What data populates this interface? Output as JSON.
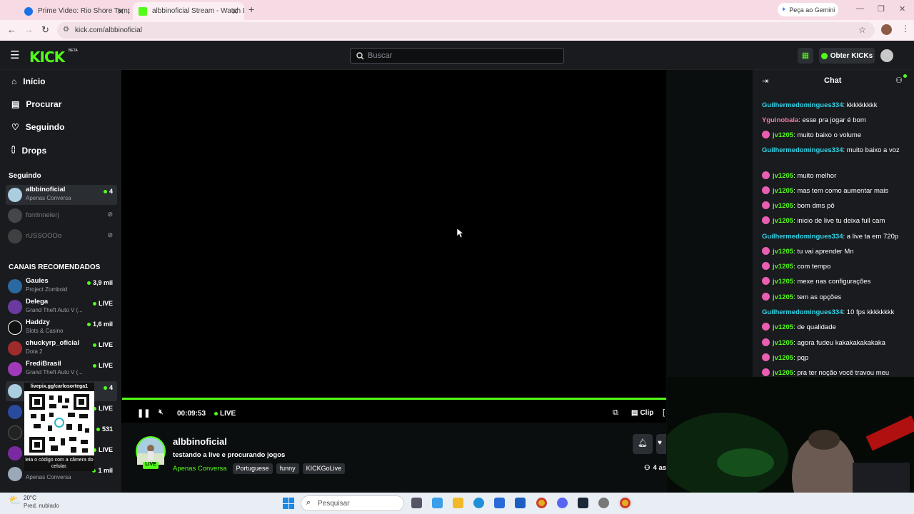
{
  "browser": {
    "tabs": [
      {
        "title": "Prime Video: Rio Shore Tempor..."
      },
      {
        "title": "albbinoficial Stream - Watch Li..."
      }
    ],
    "gemini_label": "Peça ao Gemini",
    "url": "kick.com/albbinoficial"
  },
  "header": {
    "logo": "KICK",
    "logo_badge": "BETA",
    "search_placeholder": "Buscar",
    "kicks_button": "Obter KICKs"
  },
  "sidebar": {
    "nav": [
      {
        "label": "Início"
      },
      {
        "label": "Procurar"
      },
      {
        "label": "Seguindo"
      },
      {
        "label": "Drops"
      }
    ],
    "following_title": "Seguindo",
    "following": [
      {
        "name": "albbinoficial",
        "category": "Apenas Conversa",
        "viewers": "4"
      },
      {
        "name": "fontinnelerj",
        "category": "",
        "viewers": ""
      },
      {
        "name": "rUSSOOOo",
        "category": "",
        "viewers": ""
      }
    ],
    "recommended_title": "CANAIS RECOMENDADOS",
    "recommended": [
      {
        "name": "Gaules",
        "category": "Project Zomboid",
        "viewers": "3,9 mil"
      },
      {
        "name": "Delega",
        "category": "Grand Theft Auto V (...",
        "viewers": "LIVE"
      },
      {
        "name": "Haddzy",
        "category": "Slots & Casino",
        "viewers": "1,6 mil"
      },
      {
        "name": "chuckyrp_oficial",
        "category": "Dota 2",
        "viewers": "LIVE"
      },
      {
        "name": "FrediBrasil",
        "category": "Grand Theft Auto V (...",
        "viewers": "LIVE"
      },
      {
        "name": "",
        "category": "",
        "viewers": "4"
      },
      {
        "name": "",
        "category": "",
        "viewers": "LIVE"
      },
      {
        "name": "",
        "category": "",
        "viewers": "531"
      },
      {
        "name": "",
        "category": "",
        "viewers": "LIVE"
      },
      {
        "name": "",
        "category": "Apenas Conversa",
        "viewers": "1 mil"
      }
    ],
    "qr": {
      "top": "livepix.gg/carlosortega1",
      "bottom": "leia o código com a câmera do celular."
    }
  },
  "player": {
    "time": "00:09:53",
    "live": "LIVE",
    "clip": "Clip",
    "progress": 1.0
  },
  "stream": {
    "channel": "albbinoficial",
    "title": "testando a live e procurando jogos",
    "category": "Apenas Conversa",
    "tags": [
      "Portuguese",
      "funny",
      "KICKGoLive"
    ],
    "live_badge": "LIVE",
    "viewers_snippet": "4 as"
  },
  "chat": {
    "title": "Chat",
    "messages": [
      {
        "user": "Guilhermedomingues334",
        "color": "cyan",
        "badge": false,
        "text": "kkkkkkkkk"
      },
      {
        "user": "Yguinobala",
        "color": "pink",
        "badge": false,
        "text": "esse pra jogar é bom"
      },
      {
        "user": "jv1205",
        "color": "green",
        "badge": true,
        "text": "muito baixo o volume"
      },
      {
        "user": "Guilhermedomingues334",
        "color": "cyan",
        "badge": false,
        "text": "muito baixo a voz"
      },
      {
        "user": "jv1205",
        "color": "green",
        "badge": true,
        "text": "muito melhor"
      },
      {
        "user": "jv1205",
        "color": "green",
        "badge": true,
        "text": "mas tem como aumentar mais"
      },
      {
        "user": "jv1205",
        "color": "green",
        "badge": true,
        "text": "bom dms pô"
      },
      {
        "user": "jv1205",
        "color": "green",
        "badge": true,
        "text": "inicio de live tu deixa full cam"
      },
      {
        "user": "Guilhermedomingues334",
        "color": "cyan",
        "badge": false,
        "text": "a live ta em 720p"
      },
      {
        "user": "jv1205",
        "color": "green",
        "badge": true,
        "text": "tu vai aprender Mn"
      },
      {
        "user": "jv1205",
        "color": "green",
        "badge": true,
        "text": "com tempo"
      },
      {
        "user": "jv1205",
        "color": "green",
        "badge": true,
        "text": "mexe nas configurações"
      },
      {
        "user": "jv1205",
        "color": "green",
        "badge": true,
        "text": "tem as opções"
      },
      {
        "user": "Guilhermedomingues334",
        "color": "cyan",
        "badge": false,
        "text": "10 fps kkkkkkkk"
      },
      {
        "user": "jv1205",
        "color": "green",
        "badge": true,
        "text": "de qualidade"
      },
      {
        "user": "jv1205",
        "color": "green",
        "badge": true,
        "text": "agora fudeu kakakakakakaka"
      },
      {
        "user": "jv1205",
        "color": "green",
        "badge": true,
        "text": "pqp"
      },
      {
        "user": "jv1205",
        "color": "green",
        "badge": true,
        "text": "pra ter noção você travou meu"
      }
    ]
  },
  "taskbar": {
    "weather_temp": "20°C",
    "weather_desc": "Pred. nublado",
    "search_placeholder": "Pesquisar"
  },
  "colors": {
    "accent": "#53fc18",
    "panel": "#191b1f",
    "background": "#0b0e0f"
  }
}
